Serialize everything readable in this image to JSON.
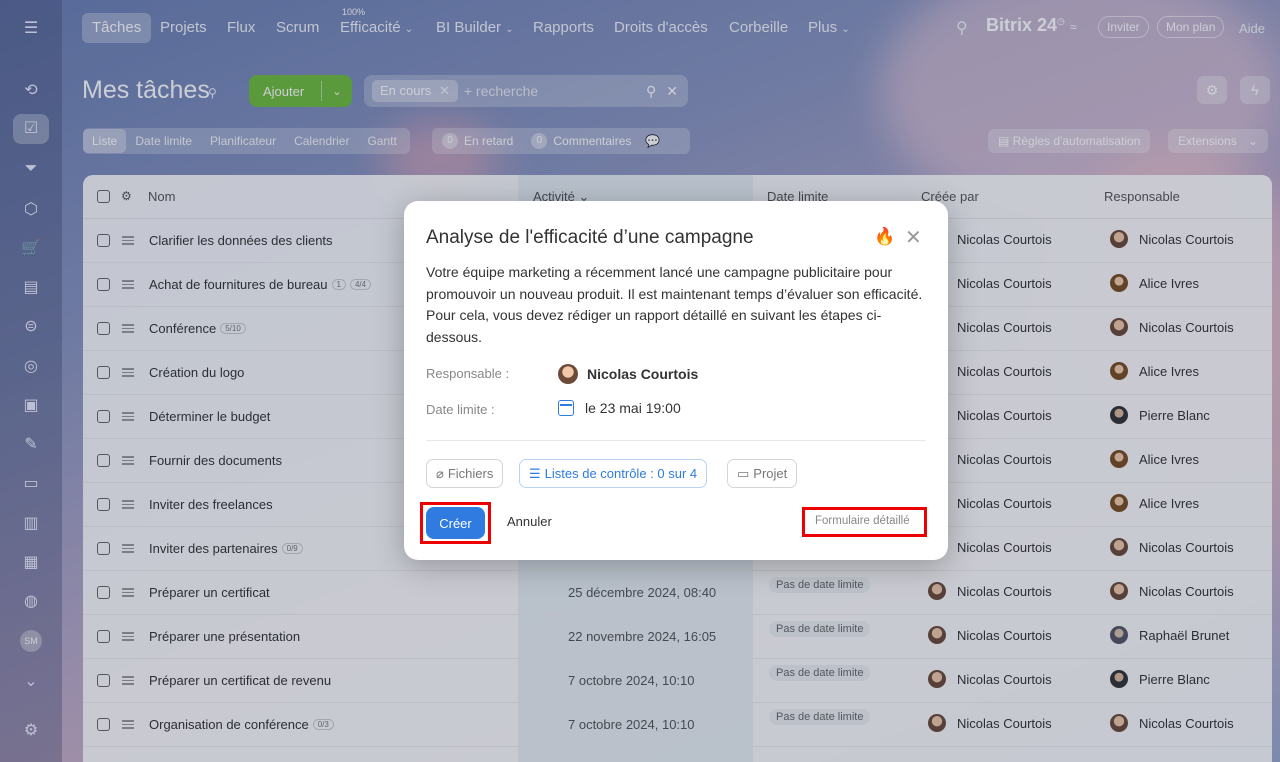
{
  "nav": {
    "items": [
      "Tâches",
      "Projets",
      "Flux",
      "Scrum",
      "Efficacité",
      "BI Builder",
      "Rapports",
      "Droits d'accès",
      "Corbeille",
      "Plus"
    ],
    "efficiency_badge": "100%",
    "logo": "Bitrix 24",
    "invite": "Inviter",
    "my_plan": "Mon plan",
    "help": "Aide"
  },
  "sidebar": {
    "icons": [
      "tasks-icon",
      "checkbox-icon",
      "funnel-icon",
      "cube-icon",
      "cart-icon",
      "contact-card-icon",
      "robot-icon",
      "target-icon",
      "store-icon",
      "sign-icon",
      "document-icon",
      "chart-icon",
      "calendar-icon",
      "headset-icon"
    ],
    "avatar_initials": "SM"
  },
  "page": {
    "title": "Mes tâches",
    "add_button": "Ajouter",
    "filter_chip": "En cours",
    "search_placeholder": "+ recherche"
  },
  "views": [
    "Liste",
    "Date limite",
    "Planificateur",
    "Calendrier",
    "Gantt"
  ],
  "counters": {
    "overdue_count": "0",
    "overdue_label": "En retard",
    "comments_count": "0",
    "comments_label": "Commentaires"
  },
  "toolbar": {
    "automation": "Règles d'automatisation",
    "extensions": "Extensions"
  },
  "table": {
    "headers": {
      "name": "Nom",
      "activity": "Activité",
      "deadline": "Date limite",
      "created_by": "Créée par",
      "responsible": "Responsable"
    },
    "rows": [
      {
        "name": "Clarifier les données des clients",
        "badges": [],
        "activity": "",
        "deadline": "",
        "creator": "Nicolas Courtois",
        "creator_av": "nc",
        "resp": "Nicolas Courtois",
        "resp_av": "nc"
      },
      {
        "name": "Achat de fournitures de bureau",
        "badges": [
          "1",
          "4/4"
        ],
        "activity": "",
        "deadline": "",
        "creator": "Nicolas Courtois",
        "creator_av": "nc",
        "resp": "Alice Ivres",
        "resp_av": "ai"
      },
      {
        "name": "Conférence",
        "badges": [
          "5/10"
        ],
        "activity": "",
        "deadline": "",
        "creator": "Nicolas Courtois",
        "creator_av": "nc",
        "resp": "Nicolas Courtois",
        "resp_av": "nc"
      },
      {
        "name": "Création du logo",
        "badges": [],
        "activity": "",
        "deadline": "",
        "creator": "Nicolas Courtois",
        "creator_av": "nc",
        "resp": "Alice Ivres",
        "resp_av": "ai"
      },
      {
        "name": "Déterminer le budget",
        "badges": [],
        "activity": "",
        "deadline": "",
        "creator": "Nicolas Courtois",
        "creator_av": "nc",
        "resp": "Pierre Blanc",
        "resp_av": "pb"
      },
      {
        "name": "Fournir des documents",
        "badges": [],
        "activity": "",
        "deadline": "",
        "creator": "Nicolas Courtois",
        "creator_av": "nc",
        "resp": "Alice Ivres",
        "resp_av": "ai"
      },
      {
        "name": "Inviter des freelances",
        "badges": [],
        "activity": "",
        "deadline": "",
        "creator": "Nicolas Courtois",
        "creator_av": "nc",
        "resp": "Alice Ivres",
        "resp_av": "ai"
      },
      {
        "name": "Inviter des partenaires",
        "badges": [
          "0/9"
        ],
        "activity": "",
        "deadline": "",
        "creator": "Nicolas Courtois",
        "creator_av": "nc",
        "resp": "Nicolas Courtois",
        "resp_av": "nc"
      },
      {
        "name": "Préparer un certificat",
        "badges": [],
        "activity": "25 décembre 2024, 08:40",
        "deadline": "Pas de date limite",
        "creator": "Nicolas Courtois",
        "creator_av": "nc",
        "resp": "Nicolas Courtois",
        "resp_av": "nc"
      },
      {
        "name": "Préparer une présentation",
        "badges": [],
        "activity": "22 novembre 2024, 16:05",
        "deadline": "Pas de date limite",
        "creator": "Nicolas Courtois",
        "creator_av": "nc",
        "resp": "Raphaël Brunet",
        "resp_av": "rb"
      },
      {
        "name": "Préparer un certificat de revenu",
        "badges": [],
        "activity": "7 octobre 2024, 10:10",
        "deadline": "Pas de date limite",
        "creator": "Nicolas Courtois",
        "creator_av": "nc",
        "resp": "Pierre Blanc",
        "resp_av": "pb"
      },
      {
        "name": "Organisation de conférence",
        "badges": [
          "0/3"
        ],
        "activity": "7 octobre 2024, 10:10",
        "deadline": "Pas de date limite",
        "creator": "Nicolas Courtois",
        "creator_av": "nc",
        "resp": "Nicolas Courtois",
        "resp_av": "nc"
      }
    ]
  },
  "modal": {
    "title": "Analyse de l'efficacité d’une campagne",
    "description": "Votre équipe marketing a récemment lancé une campagne publicitaire pour promouvoir un nouveau produit. Il est maintenant temps d’évaluer son efficacité. Pour cela, vous devez rédiger un rapport détaillé en suivant les étapes ci-dessous.",
    "responsible_label": "Responsable :",
    "responsible_value": "Nicolas Courtois",
    "deadline_label": "Date limite :",
    "deadline_value": "le 23 mai 19:00",
    "files": "Fichiers",
    "checklists": "Listes de contrôle : 0 sur 4",
    "project": "Projet",
    "create": "Créer",
    "cancel": "Annuler",
    "detailed_form": "Formulaire détaillé"
  }
}
